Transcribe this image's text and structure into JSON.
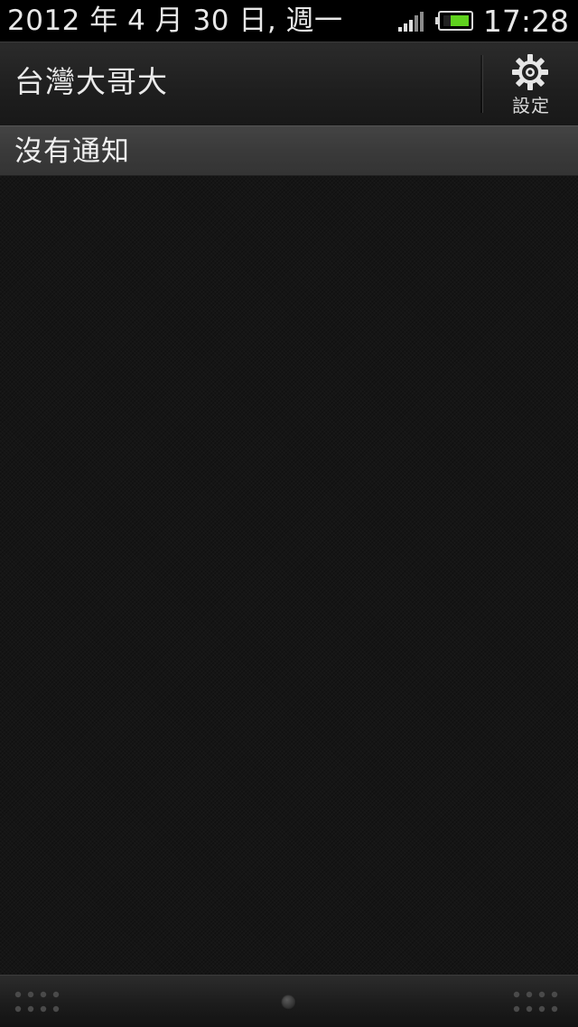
{
  "status_bar": {
    "date": "2012 年 4 月 30 日, 週一",
    "time": "17:28",
    "signal_icon": "signal-bars-icon",
    "battery_icon": "battery-icon",
    "battery_color": "#5fd11e"
  },
  "header": {
    "carrier": "台灣大哥大",
    "settings_label": "設定",
    "settings_icon": "gear-icon"
  },
  "notifications": {
    "empty_label": "沒有通知"
  },
  "bottom_bar": {
    "left_icon": "grip-dots-icon",
    "right_icon": "grip-dots-icon",
    "center_icon": "home-handle-icon"
  }
}
